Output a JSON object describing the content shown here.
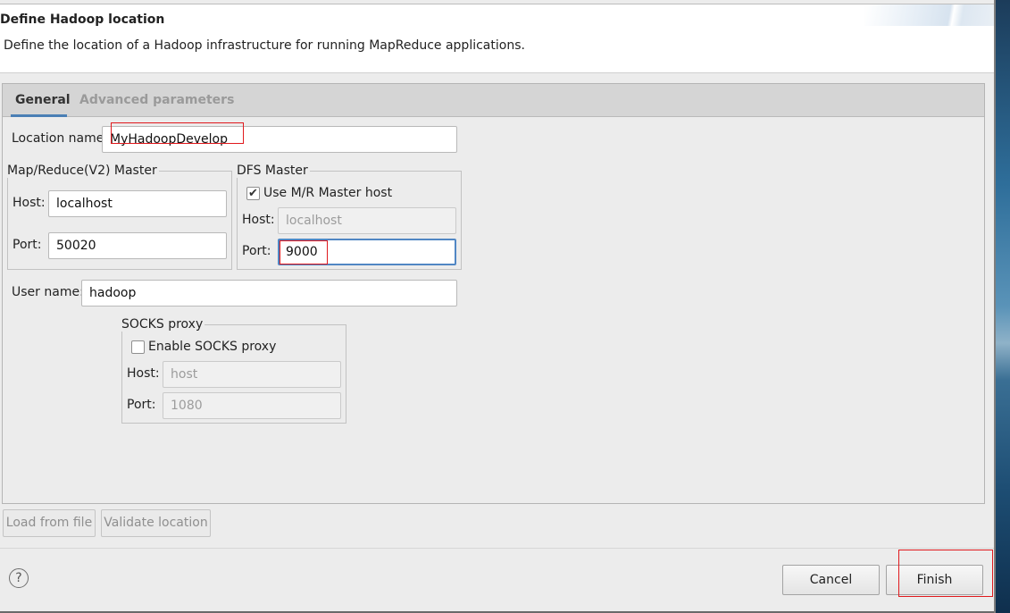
{
  "header": {
    "title": "Define Hadoop location",
    "description": "Define the location of a Hadoop infrastructure for running MapReduce applications."
  },
  "tabs": [
    {
      "label": "General",
      "selected": true
    },
    {
      "label": "Advanced parameters",
      "selected": false
    }
  ],
  "general": {
    "location_name": {
      "label": "Location name:",
      "value": "MyHadoopDevelop"
    },
    "mr_master": {
      "title": "Map/Reduce(V2) Master",
      "host_label": "Host:",
      "host_value": "localhost",
      "port_label": "Port:",
      "port_value": "50020"
    },
    "dfs_master": {
      "title": "DFS Master",
      "use_mr_host_label": "Use M/R Master host",
      "use_mr_host_checked": true,
      "check_glyph": "✔",
      "host_label": "Host:",
      "host_value": "localhost",
      "port_label": "Port:",
      "port_value": "9000"
    },
    "user_name": {
      "label": "User name:",
      "value": "hadoop"
    },
    "socks_proxy": {
      "title": "SOCKS proxy",
      "enable_label": "Enable SOCKS proxy",
      "enabled": false,
      "host_label": "Host:",
      "host_value": "host",
      "port_label": "Port:",
      "port_value": "1080"
    }
  },
  "actions": {
    "load_from_file": "Load from file",
    "validate_location": "Validate location"
  },
  "footer": {
    "help_glyph": "?",
    "cancel": "Cancel",
    "finish": "Finish"
  },
  "colors": {
    "annotation_red": "#e0191d",
    "focus_blue": "#5187c4",
    "dialog_bg": "#ececec"
  },
  "icons": [
    "help-icon",
    "checkmark-icon"
  ]
}
